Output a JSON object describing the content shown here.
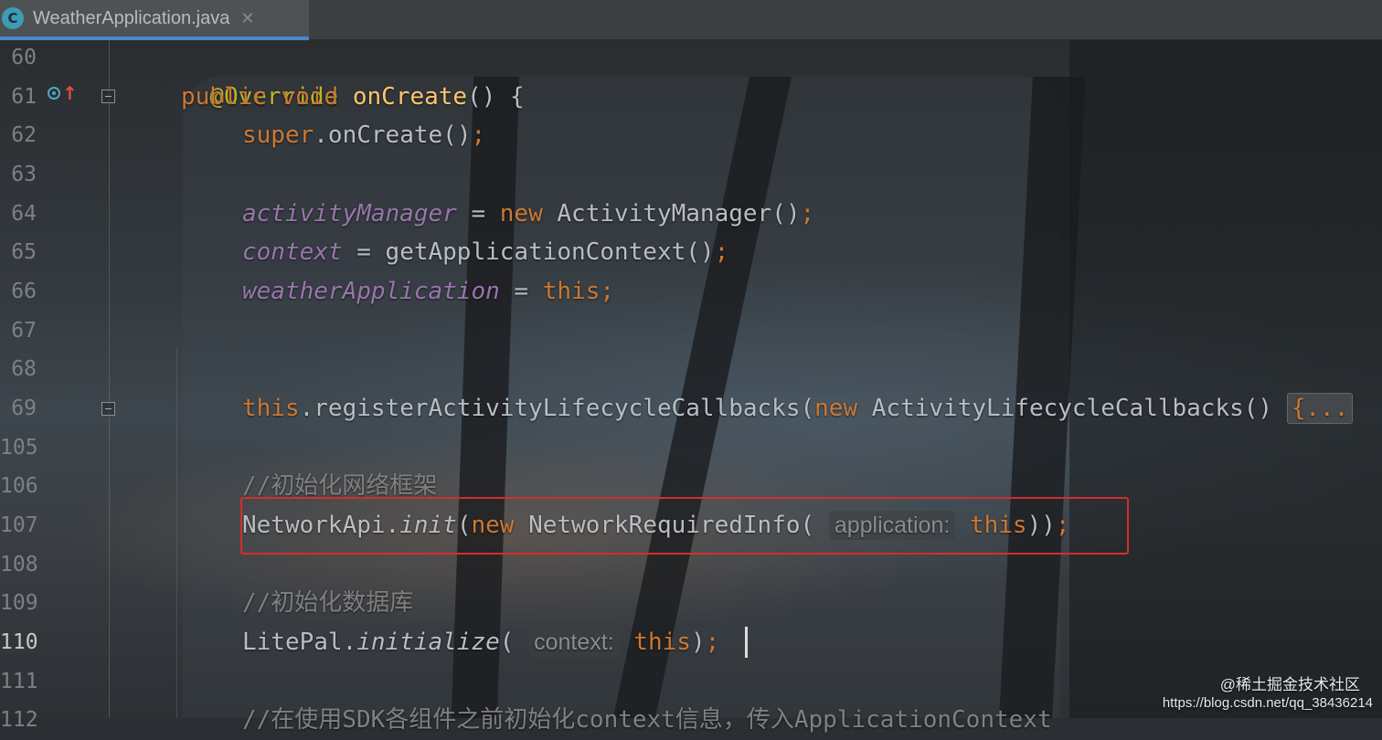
{
  "tab": {
    "icon": "C",
    "filename": "WeatherApplication.java",
    "close": "✕"
  },
  "gutter": {
    "line_numbers": [
      "60",
      "61",
      "62",
      "63",
      "64",
      "65",
      "66",
      "67",
      "68",
      "69",
      "105",
      "106",
      "107",
      "108",
      "109",
      "110",
      "111",
      "112"
    ],
    "current_line": "110"
  },
  "code": {
    "l60": {
      "annotation": "@Override"
    },
    "l61": {
      "kw1": "public",
      "kw2": "void",
      "method": "onCreate",
      "rest": "() {"
    },
    "l62": {
      "kw": "super",
      "rest": ".onCreate()",
      "semi": ";"
    },
    "l64": {
      "field": "activityManager",
      "eq": " = ",
      "kw": "new",
      "rest": " ActivityManager()",
      "semi": ";"
    },
    "l65": {
      "field": "context",
      "rest": " = getApplicationContext()",
      "semi": ";"
    },
    "l66": {
      "field": "weatherApplication",
      "eq": " = ",
      "kw": "this",
      "semi": ";"
    },
    "l69": {
      "kw1": "this",
      "mid": ".registerActivityLifecycleCallbacks(",
      "kw2": "new",
      "rest": " ActivityLifecycleCallbacks() ",
      "fold": "{..."
    },
    "l106": {
      "comment": "//初始化网络框架"
    },
    "l107": {
      "cls": "NetworkApi.",
      "static": "init",
      "open": "(",
      "kw1": "new",
      "rest": " NetworkRequiredInfo( ",
      "hint": "application:",
      "kw2": "this",
      "close": "))",
      "semi": ";"
    },
    "l109": {
      "comment": "//初始化数据库"
    },
    "l110": {
      "cls": "LitePal.",
      "static": "initialize",
      "open": "( ",
      "hint": "context:",
      "kw": "this",
      "close": ")",
      "semi": ";"
    },
    "l112": {
      "comment": "//在使用SDK各组件之前初始化context信息，传入ApplicationContext"
    }
  },
  "watermark": {
    "line1": "@稀土掘金技术社区",
    "line2": "https://blog.csdn.net/qq_38436214"
  }
}
